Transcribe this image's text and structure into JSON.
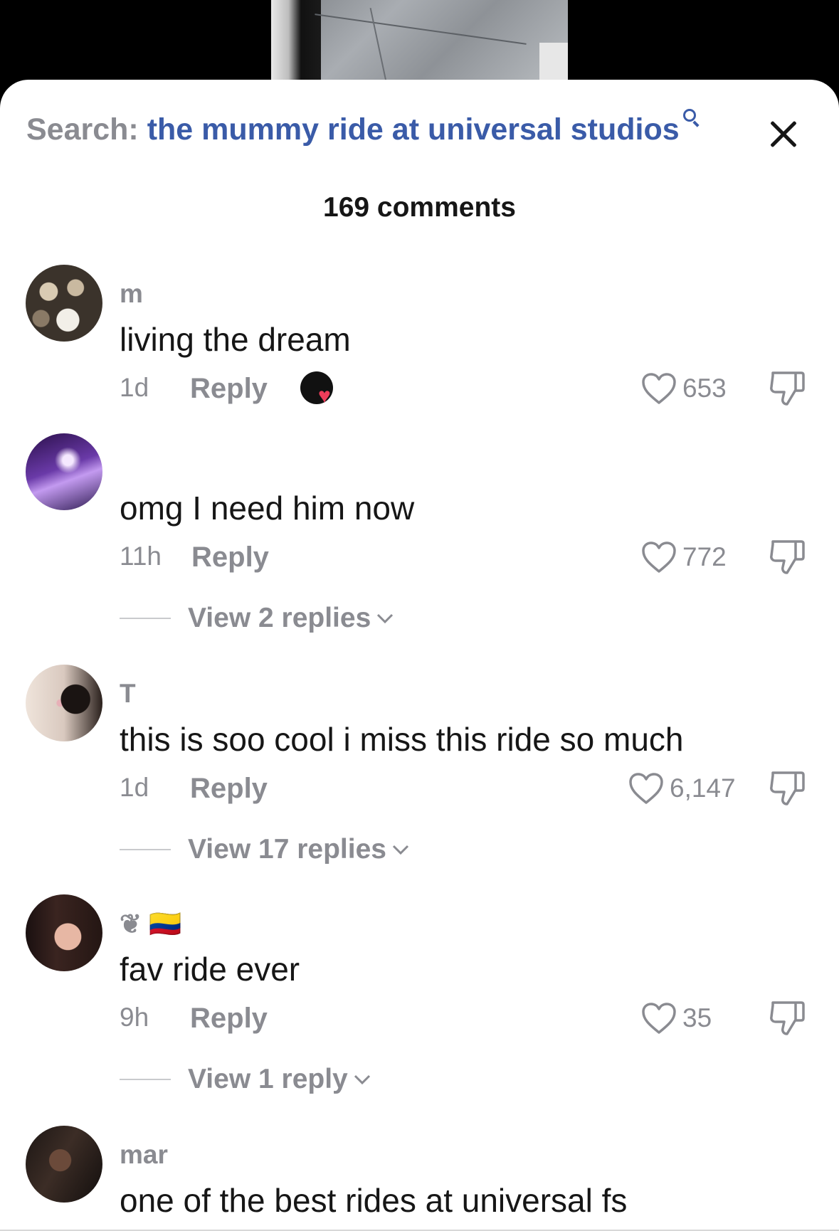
{
  "search": {
    "prefix": "Search:",
    "query": "the mummy ride at universal studios"
  },
  "comment_count": "169 comments",
  "reply_label": "Reply",
  "comments": [
    {
      "username": "m",
      "text": "living the dream",
      "time": "1d",
      "likes": "653",
      "creator_liked": true,
      "replies": ""
    },
    {
      "username": "",
      "text": "omg I need him now",
      "time": "11h",
      "likes": "772",
      "creator_liked": false,
      "replies": "View 2 replies"
    },
    {
      "username": "T",
      "text": "this is soo cool i miss this ride so much",
      "time": "1d",
      "likes": "6,147",
      "creator_liked": false,
      "replies": "View 17 replies"
    },
    {
      "username": "❦ 🇨🇴",
      "text": "fav ride ever",
      "time": "9h",
      "likes": "35",
      "creator_liked": false,
      "replies": "View 1 reply"
    },
    {
      "username": "mar",
      "text": "one of the best rides at universal fs",
      "time": "",
      "likes": "",
      "creator_liked": false,
      "replies": ""
    }
  ],
  "colors": {
    "query_blue": "#3a5ba8",
    "muted_gray": "#8a8b91",
    "text_black": "#161616",
    "creator_heart": "#ef3d5a"
  }
}
